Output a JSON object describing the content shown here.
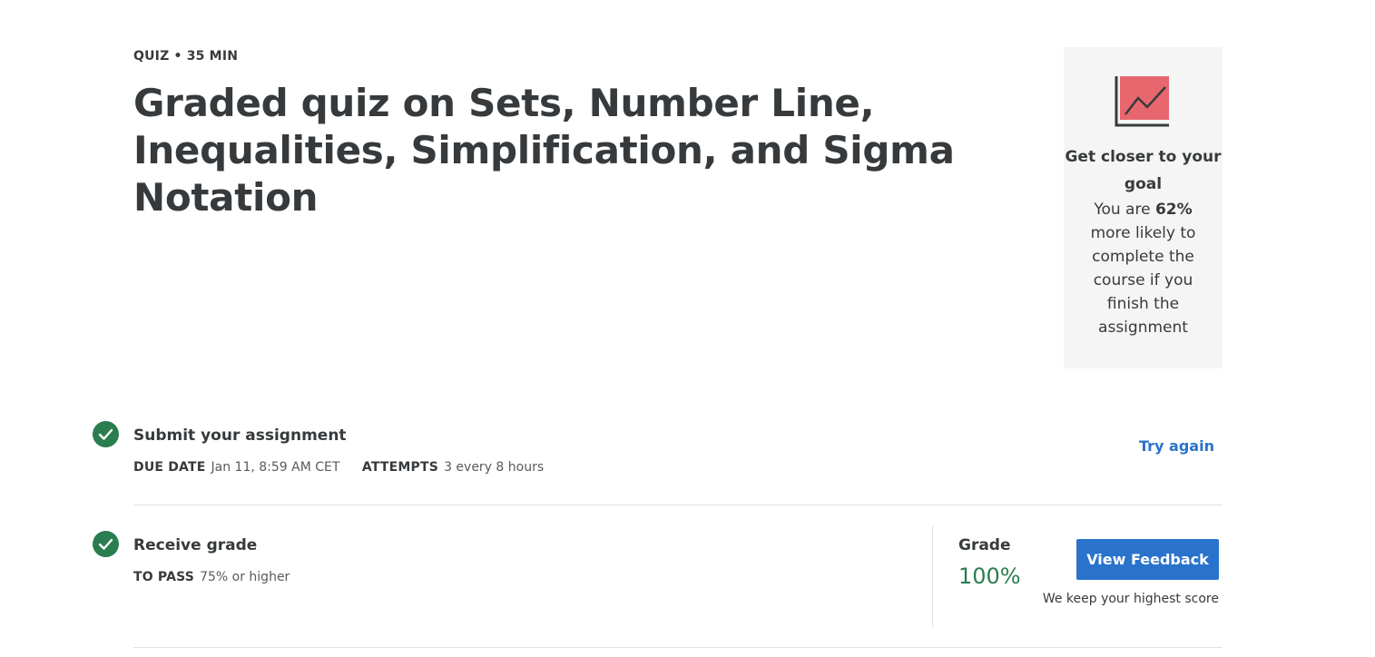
{
  "header": {
    "meta": "QUIZ • 35 MIN",
    "title": "Graded quiz on Sets, Number Line, Inequalities, Simplification, and Sigma Notation"
  },
  "goal_card": {
    "icon": "chart-trend-icon",
    "heading": "Get closer to your goal",
    "body_prefix": "You are",
    "percent": "62%",
    "body_suffix": "more likely to complete the course if you finish the assignment"
  },
  "submit": {
    "title": "Submit your assignment",
    "due_label": "DUE DATE",
    "due_value": "Jan 11, 8:59 AM CET",
    "attempts_label": "ATTEMPTS",
    "attempts_value": "3 every 8 hours",
    "try_again": "Try again",
    "status_icon": "check-circle-icon"
  },
  "grade": {
    "title": "Receive grade",
    "pass_label": "TO PASS",
    "pass_value": "75% or higher",
    "grade_label": "Grade",
    "grade_value": "100%",
    "view_feedback": "View Feedback",
    "highest_note": "We keep your highest score",
    "status_icon": "check-circle-icon"
  },
  "colors": {
    "accent_blue": "#2a73cc",
    "success_green": "#2a7d4f",
    "card_bg": "#f5f5f5",
    "icon_red": "#e8676f"
  }
}
